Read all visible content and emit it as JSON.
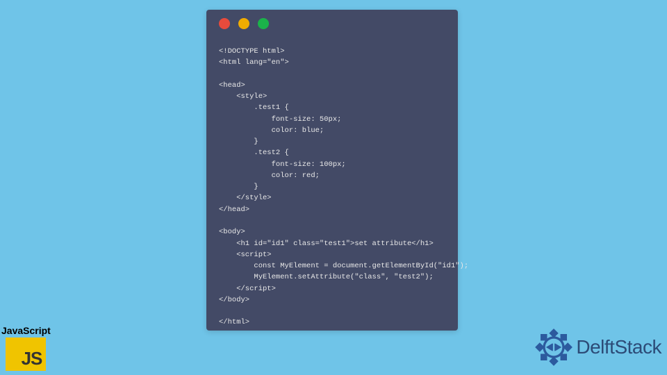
{
  "codeWindow": {
    "lines": [
      "<!DOCTYPE html>",
      "<html lang=\"en\">",
      "",
      "<head>",
      "    <style>",
      "        .test1 {",
      "            font-size: 50px;",
      "            color: blue;",
      "        }",
      "        .test2 {",
      "            font-size: 100px;",
      "            color: red;",
      "        }",
      "    </style>",
      "</head>",
      "",
      "<body>",
      "    <h1 id=\"id1\" class=\"test1\">set attribute</h1>",
      "    <script>",
      "        const MyElement = document.getElementById(\"id1\");",
      "        MyElement.setAttribute(\"class\", \"test2\");",
      "    </script>",
      "</body>",
      "",
      "</html>"
    ]
  },
  "jsBadge": {
    "label": "JavaScript",
    "logoText": "JS"
  },
  "delftBadge": {
    "brand": "DelftStack"
  }
}
